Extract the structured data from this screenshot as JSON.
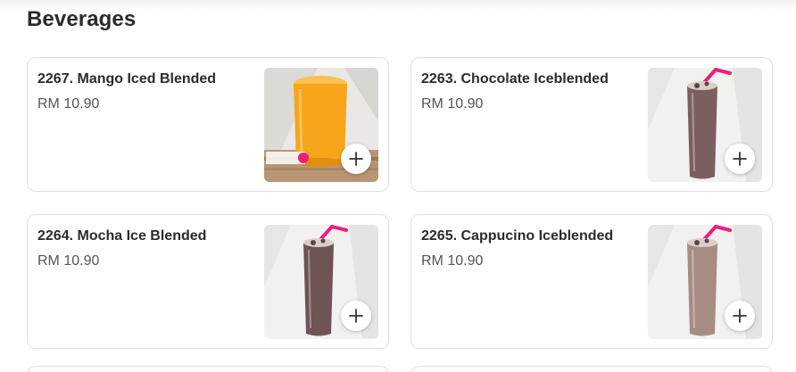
{
  "section": {
    "title": "Beverages"
  },
  "items": [
    {
      "title": "2267. Mango Iced Blended",
      "price": "RM 10.90",
      "drink_color": "#f7a51b",
      "image_type": "mango",
      "badge_text": "foodpanda"
    },
    {
      "title": "2263. Chocolate Iceblended",
      "price": "RM 10.90",
      "drink_color": "#7b5f60",
      "image_type": "tall"
    },
    {
      "title": "2264. Mocha Ice Blended",
      "price": "RM 10.90",
      "drink_color": "#6e5455",
      "image_type": "tall"
    },
    {
      "title": "2265. Cappucino Iceblended",
      "price": "RM 10.90",
      "drink_color": "#a68c83",
      "image_type": "tall"
    }
  ],
  "icons": {
    "add": "plus-icon"
  },
  "colors": {
    "accent_pink": "#e8207c",
    "text_dark": "#2b2b2b",
    "border": "#e0e0e0"
  }
}
